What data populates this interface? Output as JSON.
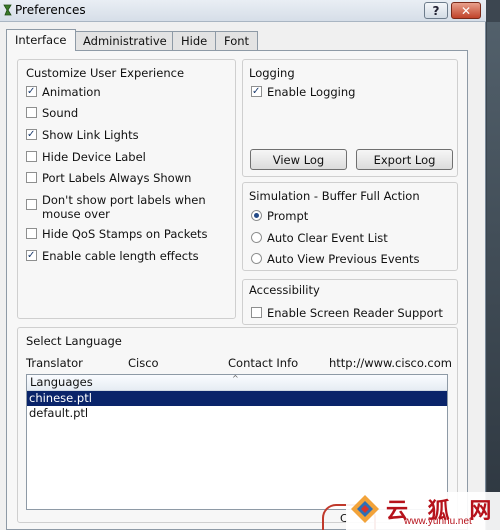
{
  "window": {
    "title": "Preferences",
    "help_label": "?",
    "close_label": "✕"
  },
  "tabs": [
    {
      "label": "Interface",
      "active": true
    },
    {
      "label": "Administrative",
      "active": false
    },
    {
      "label": "Hide",
      "active": false
    },
    {
      "label": "Font",
      "active": false
    }
  ],
  "customize": {
    "title": "Customize User Experience",
    "options": [
      {
        "label": "Animation",
        "checked": true
      },
      {
        "label": "Sound",
        "checked": false
      },
      {
        "label": "Show Link Lights",
        "checked": true
      },
      {
        "label": "Hide Device Label",
        "checked": false
      },
      {
        "label": "Port Labels Always Shown",
        "checked": false
      },
      {
        "label": "Don't show port labels when",
        "label2": "mouse over",
        "checked": false
      },
      {
        "label": "Hide QoS Stamps on Packets",
        "checked": false
      },
      {
        "label": "Enable cable length effects",
        "checked": true
      }
    ]
  },
  "logging": {
    "title": "Logging",
    "enable_label": "Enable Logging",
    "enable_checked": true,
    "view_log_label": "View Log",
    "export_log_label": "Export Log"
  },
  "simulation": {
    "title": "Simulation - Buffer Full Action",
    "options": [
      {
        "label": "Prompt",
        "selected": true
      },
      {
        "label": "Auto Clear Event List",
        "selected": false
      },
      {
        "label": "Auto View Previous Events",
        "selected": false
      }
    ]
  },
  "accessibility": {
    "title": "Accessibility",
    "screen_reader_label": "Enable Screen Reader Support",
    "screen_reader_checked": false
  },
  "language": {
    "title": "Select Language",
    "translator_label": "Translator",
    "translator_value": "Cisco",
    "contact_label": "Contact Info",
    "contact_value": "http://www.cisco.com",
    "column_header": "Languages",
    "sort_caret": "^",
    "items": [
      {
        "label": "chinese.ptl",
        "selected": true
      },
      {
        "label": "default.ptl",
        "selected": false
      }
    ]
  },
  "bottom": {
    "partial_button_label": "C"
  },
  "watermark": {
    "chars": "云  狐  网",
    "url": "www.yunhu.net"
  }
}
